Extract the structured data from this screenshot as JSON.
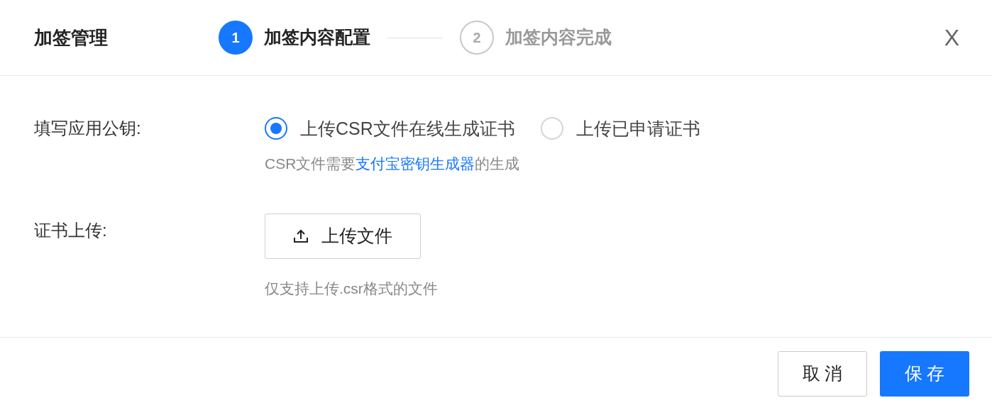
{
  "dialog": {
    "title": "加签管理",
    "close": "X"
  },
  "steps": [
    {
      "number": "1",
      "label": "加签内容配置",
      "active": true
    },
    {
      "number": "2",
      "label": "加签内容完成",
      "active": false
    }
  ],
  "form": {
    "key_label": "填写应用公钥:",
    "options": [
      {
        "label": "上传CSR文件在线生成证书",
        "selected": true
      },
      {
        "label": "上传已申请证书",
        "selected": false
      }
    ],
    "key_hint": {
      "prefix": "CSR文件需要",
      "link": "支付宝密钥生成器",
      "suffix": "的生成"
    },
    "upload_label": "证书上传:",
    "upload_button": "上传文件",
    "upload_hint": "仅支持上传.csr格式的文件"
  },
  "footer": {
    "cancel": "取 消",
    "save": "保 存"
  }
}
